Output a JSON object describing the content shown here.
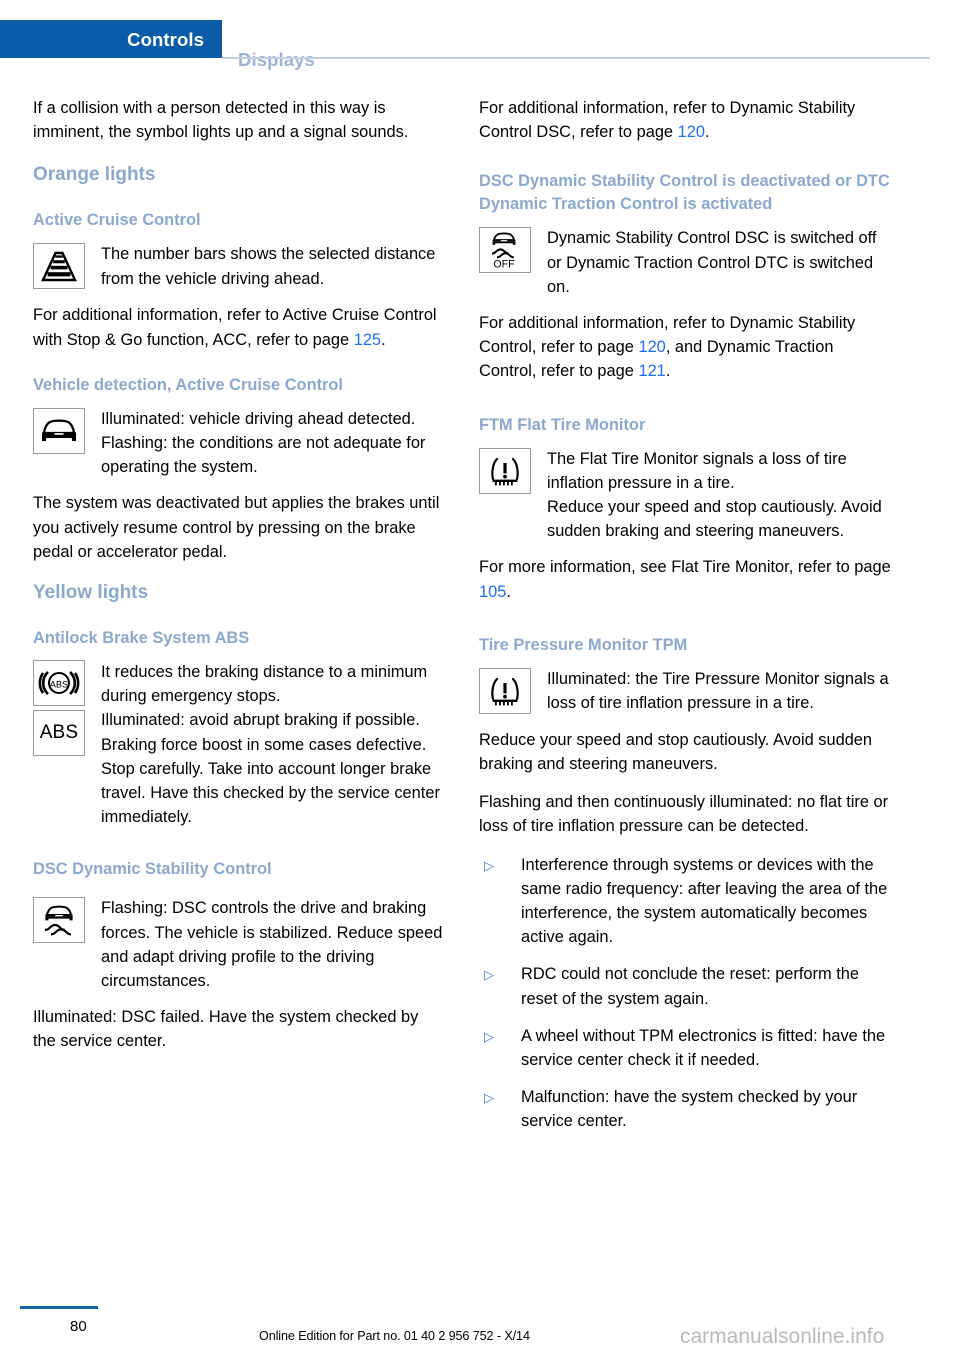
{
  "header": {
    "tab_active": "Controls",
    "tab_inactive": "Displays",
    "accent_color": "#0b5ca8",
    "rule_color": "#bdd0e6"
  },
  "footer": {
    "page_number": "80",
    "edition_note": "Online Edition for Part no. 01 40 2 956 752 - X/14",
    "watermark": "carmanualsonline.info",
    "rule_color": "#1763a8"
  },
  "colors": {
    "heading_blue": "#8ba8cd",
    "page_ref_blue": "#1d6ff2",
    "bullet_blue": "#3b7dd8",
    "icon_border": "#9a9a9a"
  },
  "left_column": {
    "intro_paragraph": "If a collision with a person detected in this way is imminent, the symbol lights up and a signal sounds.",
    "section_orange": "Orange lights",
    "acc": {
      "heading": "Active Cruise Control",
      "icon_name": "distance-bars-icon",
      "icon_text": "The number bars shows the selected distance from the vehicle driving ahead.",
      "followup_pre": "For additional information, refer to Active Cruise Control with Stop & Go function, ACC, refer to page ",
      "followup_ref": "125",
      "followup_post": "."
    },
    "vehicle_detection": {
      "heading": "Vehicle detection, Active Cruise Control",
      "icon_name": "car-front-icon",
      "icon_text_1": "Illuminated: vehicle driving ahead detected.",
      "icon_text_2": "Flashing: the conditions are not adequate for operating the system.",
      "paragraph": "The system was deactivated but applies the brakes until you actively resume control by pressing on the brake pedal or accelerator pedal."
    },
    "section_yellow": "Yellow lights",
    "abs": {
      "heading": "Antilock Brake System ABS",
      "icon_1_name": "abs-circle-icon",
      "icon_2_name": "abs-text-icon",
      "icon_2_label": "ABS",
      "icon_text_1": "It reduces the braking distance to a minimum during emergency stops.",
      "icon_text_2": "Illuminated: avoid abrupt braking if possible. Braking force boost in some cases defective. Stop carefully. Take into account longer brake travel. Have this checked by the service center immediately."
    },
    "dsc": {
      "heading": "DSC Dynamic Stability Control",
      "icon_name": "dsc-skid-icon",
      "icon_text": "Flashing: DSC controls the drive and braking forces. The vehicle is stabilized. Reduce speed and adapt driving profile to the driving circumstances.",
      "paragraph": "Illuminated: DSC failed. Have the system checked by the service center."
    }
  },
  "right_column": {
    "dsc_followup_pre": "For additional information, refer to Dynamic Stability Control DSC, refer to page ",
    "dsc_followup_ref": "120",
    "dsc_followup_post": ".",
    "dsc_off": {
      "heading": "DSC Dynamic Stability Control is deactivated or DTC Dynamic Traction Control is activated",
      "icon_name": "dsc-off-icon",
      "icon_label": "OFF",
      "icon_text": "Dynamic Stability Control DSC is switched off or Dynamic Traction Control DTC is switched on.",
      "followup_pre": "For additional information, refer to Dynamic Stability Control, refer to page ",
      "followup_ref_1": "120",
      "followup_mid": ", and Dynamic Traction Control, refer to page ",
      "followup_ref_2": "121",
      "followup_post": "."
    },
    "ftm": {
      "heading": "FTM Flat Tire Monitor",
      "icon_name": "flat-tire-warning-icon",
      "icon_text_1": "The Flat Tire Monitor signals a loss of tire inflation pressure in a tire.",
      "icon_text_2": "Reduce your speed and stop cautiously. Avoid sudden braking and steering maneuvers.",
      "followup_pre": "For more information, see Flat Tire Monitor, refer to page ",
      "followup_ref": "105",
      "followup_post": "."
    },
    "tpm": {
      "heading": "Tire Pressure Monitor TPM",
      "icon_name": "tire-pressure-warning-icon",
      "icon_text": "Illuminated: the Tire Pressure Monitor signals a loss of tire inflation pressure in a tire.",
      "paragraph_1": "Reduce your speed and stop cautiously. Avoid sudden braking and steering maneuvers.",
      "paragraph_2": "Flashing and then continuously illuminated: no flat tire or loss of tire inflation pressure can be detected.",
      "bullet_marker": "▷",
      "bullets": [
        "Interference through systems or devices with the same radio frequency: after leaving the area of the interference, the system automatically becomes active again.",
        "RDC could not conclude the reset: perform the reset of the system again.",
        "A wheel without TPM electronics is fitted: have the service center check it if needed.",
        "Malfunction: have the system checked by your service center."
      ]
    }
  }
}
